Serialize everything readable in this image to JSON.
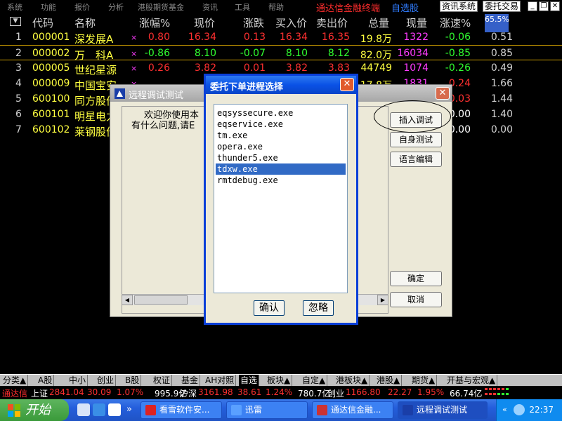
{
  "menu": {
    "items": [
      "系统",
      "功能",
      "报价",
      "分析",
      "港股期货基金",
      "资讯",
      "工具",
      "帮助"
    ],
    "app_title": "通达信金融终端",
    "app_subtitle": "自选股",
    "buttons": [
      "资讯系统",
      "委托交易"
    ],
    "window_controls": [
      "minimize-icon",
      "restore-icon",
      "close-icon"
    ]
  },
  "quote": {
    "sort_glyph": "▼",
    "columns": [
      "代码",
      "名称",
      "涨幅%",
      "现价",
      "涨跌",
      "买入价",
      "卖出价",
      "总量",
      "现量",
      "涨速%"
    ],
    "speed_badge": "65.5%",
    "rows": [
      {
        "idx": "1",
        "code": "000001",
        "name": "深发展A",
        "mark": "×",
        "pct": "0.80",
        "price": "16.34",
        "chg": "0.13",
        "buy": "16.34",
        "sell": "16.35",
        "vol": "19.8万",
        "cur": "1322",
        "spd": "-0.06",
        "last": "0.51",
        "dir": "up"
      },
      {
        "idx": "2",
        "code": "000002",
        "name": "万　科A",
        "mark": "×",
        "pct": "-0.86",
        "price": "8.10",
        "chg": "-0.07",
        "buy": "8.10",
        "sell": "8.12",
        "vol": "82.0万",
        "cur": "16034",
        "spd": "-0.85",
        "last": "0.85",
        "dir": "down"
      },
      {
        "idx": "3",
        "code": "000005",
        "name": "世纪星源",
        "mark": "×",
        "pct": "0.26",
        "price": "3.82",
        "chg": "0.01",
        "buy": "3.82",
        "sell": "3.83",
        "vol": "44749",
        "cur": "1074",
        "spd": "-0.26",
        "last": "0.49",
        "dir": "up"
      },
      {
        "idx": "4",
        "code": "000009",
        "name": "中国宝安",
        "mark": "×",
        "pct": "",
        "price": "",
        "chg": "",
        "buy": "",
        "sell": "",
        "vol": "17.8万",
        "cur": "1831",
        "spd": "0.24",
        "last": "1.66",
        "dir": "up"
      },
      {
        "idx": "5",
        "code": "600100",
        "name": "同方股份",
        "mark": "",
        "pct": "",
        "price": "",
        "chg": "",
        "buy": "",
        "sell": "",
        "vol": "",
        "cur": "",
        "spd": "0.03",
        "last": "1.44",
        "dir": "down"
      },
      {
        "idx": "6",
        "code": "600101",
        "name": "明星电力",
        "mark": "",
        "pct": "",
        "price": "",
        "chg": "",
        "buy": "",
        "sell": "",
        "vol": "",
        "cur": "",
        "spd": "0.00",
        "last": "1.40",
        "dir": "flat"
      },
      {
        "idx": "7",
        "code": "600102",
        "name": "莱钢股份",
        "mark": "",
        "pct": "",
        "price": "",
        "chg": "",
        "buy": "",
        "sell": "",
        "vol": "",
        "cur": "",
        "spd": "0.00",
        "last": "0.00",
        "dir": "flat"
      }
    ]
  },
  "tabs": [
    "分类▲",
    "A股",
    "中小",
    "创业",
    "B股",
    "权证",
    "基金",
    "AH对照",
    "自选",
    "板块▲",
    "自定▲",
    "港板块▲",
    "港股▲",
    "期货▲",
    "开基与宏观▲"
  ],
  "active_tab": "自选",
  "index_strip": {
    "brand": "通达信",
    "sh_label": "上证",
    "sh_value": "2841.04",
    "sh_chg": "30.09",
    "sh_pct": "1.07%",
    "sh_amt": "995.9亿",
    "hs_label": "沪深",
    "hs_value": "3161.98",
    "hs_chg": "38.61",
    "hs_pct": "1.24%",
    "hs_amt": "780.7亿",
    "cy_label": "创业",
    "cy_value": "1166.80",
    "cy_chg": "22.27",
    "cy_pct": "1.95%",
    "cy_amt": "66.74亿"
  },
  "taskbar": {
    "start_label": "开始",
    "quick_launch": [
      "desktop-icon",
      "ie-icon",
      "word-icon"
    ],
    "more_glyph": "»",
    "tasks": [
      "看雪软件安...",
      "迅雷",
      "通达信金融...",
      "远程调试测试"
    ],
    "active_task": "远程调试测试",
    "clock": "22:37"
  },
  "remote_dialog": {
    "title": "远程调试测试",
    "close_glyph": "✕",
    "welcome_line1": "欢迎你使用本",
    "welcome_line2": "有什么问题,请E",
    "buttons": [
      "插入调试",
      "自身测试",
      "语言编辑",
      "确定",
      "取消"
    ],
    "scroll_left": "◀",
    "scroll_right": "▶"
  },
  "proc_dialog": {
    "title": "委托下单进程选择",
    "close_glyph": "✕",
    "processes": [
      "eqsyssecure.exe",
      "eqservice.exe",
      "tm.exe",
      "opera.exe",
      "thunder5.exe",
      "tdxw.exe",
      "rmtdebug.exe"
    ],
    "selected": "tdxw.exe",
    "ok_label": "确认",
    "ignore_label": "忽略"
  },
  "colors": {
    "up": "#ff3030",
    "down": "#30ff30",
    "accent": "#0a52e6",
    "selection": "#316ac5"
  }
}
